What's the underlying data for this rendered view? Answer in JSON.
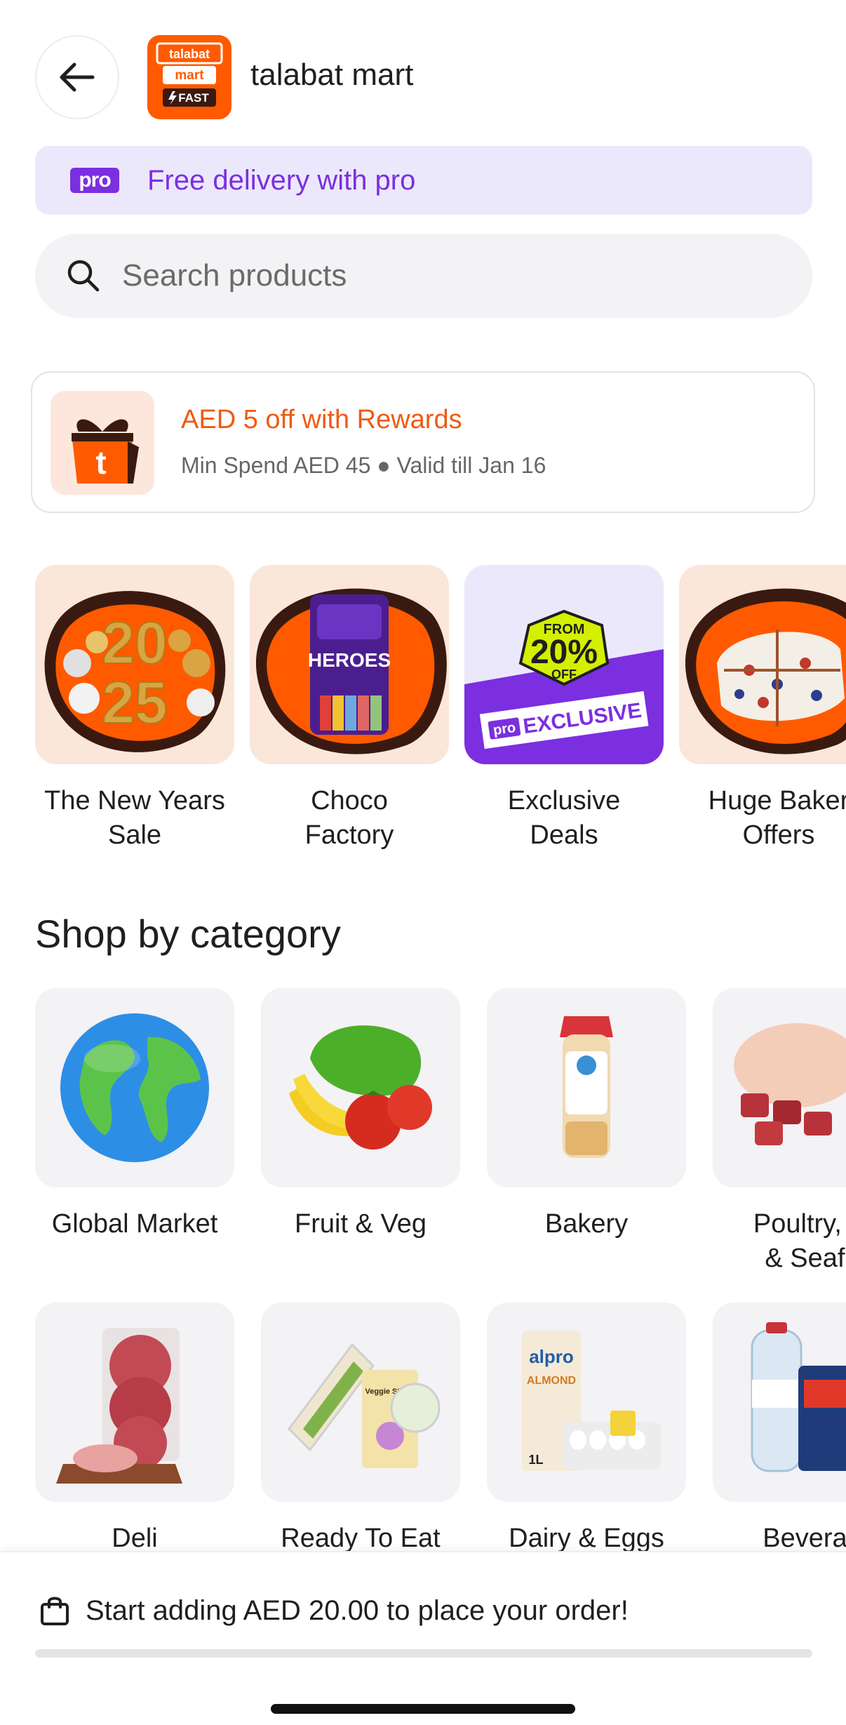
{
  "header": {
    "title": "talabat mart",
    "logo_lines": [
      "talabat",
      "mart",
      "FAST"
    ]
  },
  "pro_banner": {
    "badge": "pro",
    "text": "Free delivery with pro"
  },
  "search": {
    "placeholder": "Search products"
  },
  "rewards": {
    "title": "AED 5 off with Rewards",
    "subtitle": "Min Spend AED 45 ● Valid till Jan 16",
    "icon_letter": "t"
  },
  "promos": [
    {
      "label": "The New Years\nSale",
      "line1": "The New Years",
      "line2": "Sale",
      "art_text": "2025"
    },
    {
      "label": "Choco Factory",
      "line1": "Choco",
      "line2": "Factory",
      "art_text": "HEROES"
    },
    {
      "label": "Exclusive Deals",
      "line1": "Exclusive",
      "line2": "Deals",
      "art_from": "FROM",
      "art_pct": "20%",
      "art_off": "OFF",
      "art_pro": "pro",
      "art_exclusive": "EXCLUSIVE"
    },
    {
      "label": "Huge Bakery Offers",
      "line1": "Huge Baker",
      "line2": "Offers"
    }
  ],
  "section_title": "Shop by category",
  "categories": [
    {
      "line1": "Global Market",
      "line2": ""
    },
    {
      "line1": "Fruit & Veg",
      "line2": ""
    },
    {
      "line1": "Bakery",
      "line2": ""
    },
    {
      "line1": "Poultry, M",
      "line2": "& Seafo"
    },
    {
      "line1": "Deli",
      "line2": ""
    },
    {
      "line1": "Ready To Eat",
      "line2": ""
    },
    {
      "line1": "Dairy & Eggs",
      "line2": ""
    },
    {
      "line1": "Beverag",
      "line2": ""
    }
  ],
  "category_art": {
    "ready_to_eat_pack": "Veggie Sticks",
    "dairy_brand": "alpro",
    "dairy_flavor": "ALMOND",
    "dairy_size": "1L"
  },
  "bottom_bar": {
    "order_text": "Start adding AED 20.00 to place your order!",
    "progress": 0
  },
  "colors": {
    "brand": "#ff5a00",
    "pro": "#7b2fe0",
    "rewards_text": "#ef5a14"
  }
}
